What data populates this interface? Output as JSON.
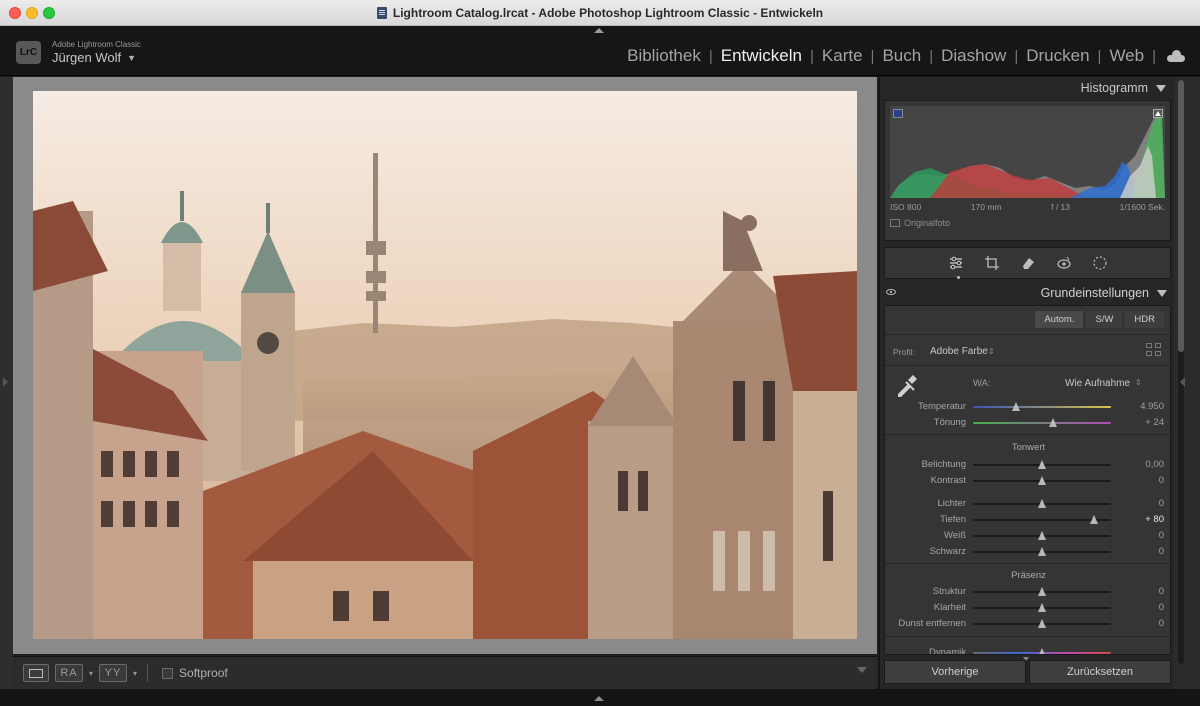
{
  "window": {
    "title": "Lightroom Catalog.lrcat - Adobe Photoshop Lightroom Classic - Entwickeln"
  },
  "identity": {
    "logo": "LrC",
    "app_name": "Adobe Lightroom Classic",
    "user": "Jürgen Wolf",
    "caret": "▼"
  },
  "modules": {
    "items": [
      "Bibliothek",
      "Entwickeln",
      "Karte",
      "Buch",
      "Diashow",
      "Drucken",
      "Web"
    ],
    "active": "Entwickeln",
    "separator": "|",
    "cloud_icon": "cloud-icon"
  },
  "toolbar": {
    "ra_label": "RA",
    "yy_label": "YY",
    "caret": "▾",
    "softproof_label": "Softproof",
    "softproof_checked": false
  },
  "histogram": {
    "title": "Histogramm",
    "iso": "ISO 800",
    "focal": "170 mm",
    "aperture": "f / 13",
    "shutter": "1/1600 Sek.",
    "original_label": "Originalfoto"
  },
  "tool_icons": [
    "sliders-icon",
    "crop-icon",
    "eraser-icon",
    "redeye-icon",
    "mask-icon"
  ],
  "basic": {
    "title": "Grundeinstellungen",
    "treatment": [
      "Autom.",
      "S/W",
      "HDR"
    ],
    "profile_label": "Profil:",
    "profile_value": "Adobe Farbe",
    "profile_arrows": "⇕",
    "wb_label": "WA:",
    "wb_value": "Wie Aufnahme",
    "wb_arrows": "⇕",
    "tone_title": "Tonwert",
    "presence_title": "Präsenz",
    "sliders": {
      "temp": {
        "label": "Temperatur",
        "value": "4.950",
        "pos": 0.31
      },
      "tint": {
        "label": "Tönung",
        "value": "+ 24",
        "pos": 0.58
      },
      "exposure": {
        "label": "Belichtung",
        "value": "0,00",
        "pos": 0.5
      },
      "contrast": {
        "label": "Kontrast",
        "value": "0",
        "pos": 0.5
      },
      "highlights": {
        "label": "Lichter",
        "value": "0",
        "pos": 0.5
      },
      "shadows": {
        "label": "Tiefen",
        "value": "+ 80",
        "pos": 0.88
      },
      "whites": {
        "label": "Weiß",
        "value": "0",
        "pos": 0.5
      },
      "blacks": {
        "label": "Schwarz",
        "value": "0",
        "pos": 0.5
      },
      "texture": {
        "label": "Struktur",
        "value": "0",
        "pos": 0.5
      },
      "clarity": {
        "label": "Klarheit",
        "value": "0",
        "pos": 0.5
      },
      "dehaze": {
        "label": "Dunst entfernen",
        "value": "0",
        "pos": 0.5
      },
      "vibrance": {
        "label": "Dynamik",
        "value": "",
        "pos": 0.5
      }
    }
  },
  "buttons": {
    "previous": "Vorherige",
    "reset": "Zurücksetzen"
  }
}
